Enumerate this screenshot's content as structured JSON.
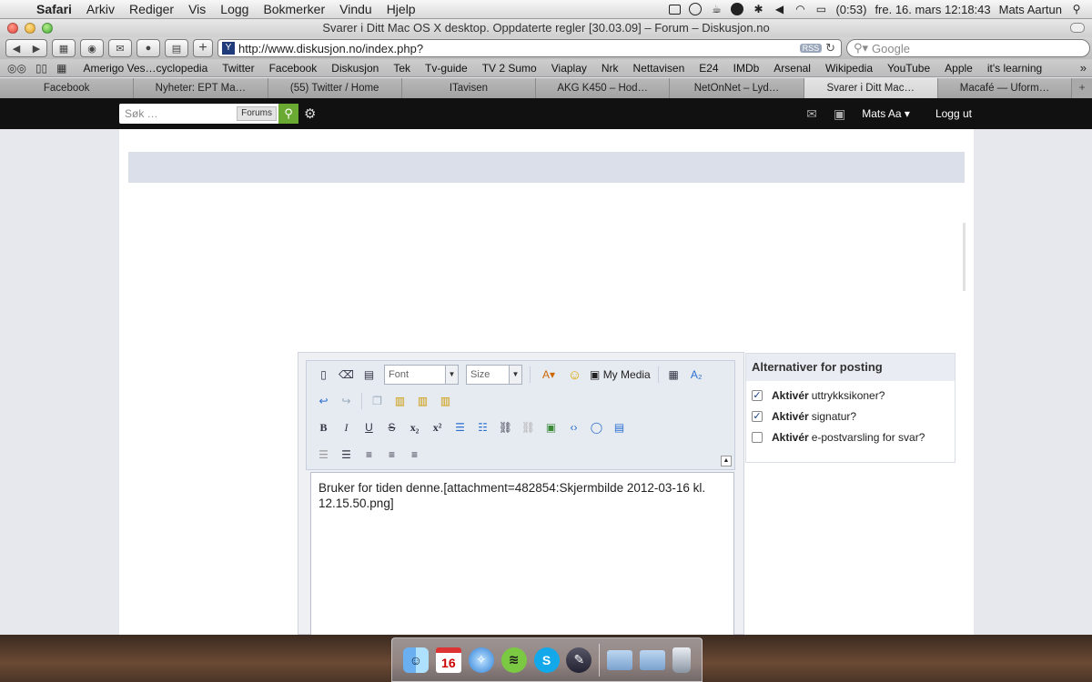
{
  "menubar": {
    "app": "Safari",
    "items": [
      "Arkiv",
      "Rediger",
      "Vis",
      "Logg",
      "Bokmerker",
      "Vindu",
      "Hjelp"
    ],
    "battery": "(0:53)",
    "datetime": "fre. 16. mars  12:18:43",
    "user": "Mats Aartun"
  },
  "window": {
    "title": "Svarer i Ditt Mac OS X desktop. Oppdaterte regler [30.03.09] – Forum – Diskusjon.no"
  },
  "toolbar": {
    "url": "http://www.diskusjon.no/index.php?",
    "rss": "RSS",
    "search_placeholder": "Google"
  },
  "bookmarks": [
    "Amerigo Ves…cyclopedia",
    "Twitter",
    "Facebook",
    "Diskusjon",
    "Tek",
    "Tv-guide",
    "TV 2 Sumo",
    "Viaplay",
    "Nrk",
    "Nettavisen",
    "E24",
    "IMDb",
    "Arsenal",
    "Wikipedia",
    "YouTube",
    "Apple",
    "it's learning"
  ],
  "tabs": [
    {
      "label": "Facebook",
      "active": false
    },
    {
      "label": "Nyheter: EPT Ma…",
      "active": false
    },
    {
      "label": "(55) Twitter / Home",
      "active": false
    },
    {
      "label": "ITavisen",
      "active": false
    },
    {
      "label": "AKG K450 – Hod…",
      "active": false
    },
    {
      "label": "NetOnNet – Lyd…",
      "active": false
    },
    {
      "label": "Svarer i Ditt Mac…",
      "active": true
    },
    {
      "label": "Macafé — Uform…",
      "active": false
    }
  ],
  "forumbar": {
    "search_placeholder": "Søk …",
    "scope": "Forums",
    "user": "Mats Aa",
    "logout": "Logg ut"
  },
  "editor": {
    "font_select": "Font",
    "size_select": "Size",
    "my_media": "My Media",
    "body": "Bruker for tiden denne.[attachment=482854:Skjermbilde 2012-03-16 kl. 12.15.50.png]"
  },
  "options": {
    "title": "Alternativer for posting",
    "items": [
      {
        "bold": "Aktivér",
        "text": "uttrykksikoner?",
        "checked": true
      },
      {
        "bold": "Aktivér",
        "text": "signatur?",
        "checked": true
      },
      {
        "bold": "Aktivér",
        "text": "e-postvarsling for svar?",
        "checked": false
      }
    ]
  },
  "dock": {
    "calendar_day": "16"
  },
  "colors": {
    "forum_bar": "#111111",
    "search_go": "#6aaa33",
    "band": "#dadfea"
  }
}
